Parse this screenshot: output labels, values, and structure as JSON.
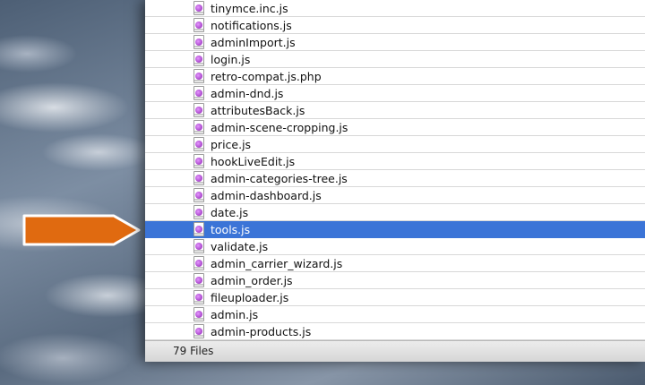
{
  "finder": {
    "files": [
      {
        "name": "tinymce.inc.js"
      },
      {
        "name": "notifications.js"
      },
      {
        "name": "adminImport.js"
      },
      {
        "name": "login.js"
      },
      {
        "name": "retro-compat.js.php"
      },
      {
        "name": "admin-dnd.js"
      },
      {
        "name": "attributesBack.js"
      },
      {
        "name": "admin-scene-cropping.js"
      },
      {
        "name": "price.js"
      },
      {
        "name": "hookLiveEdit.js"
      },
      {
        "name": "admin-categories-tree.js"
      },
      {
        "name": "admin-dashboard.js"
      },
      {
        "name": "date.js"
      },
      {
        "name": "tools.js",
        "selected": true
      },
      {
        "name": "validate.js"
      },
      {
        "name": "admin_carrier_wizard.js"
      },
      {
        "name": "admin_order.js"
      },
      {
        "name": "fileuploader.js"
      },
      {
        "name": "admin.js"
      },
      {
        "name": "admin-products.js"
      }
    ],
    "status": "79 Files",
    "file_icon": "javascript-file-icon",
    "selection_color": "#3b74d7"
  },
  "annotation": {
    "arrow_color": "#e06a10",
    "arrow_icon": "orange-pointer-arrow"
  }
}
